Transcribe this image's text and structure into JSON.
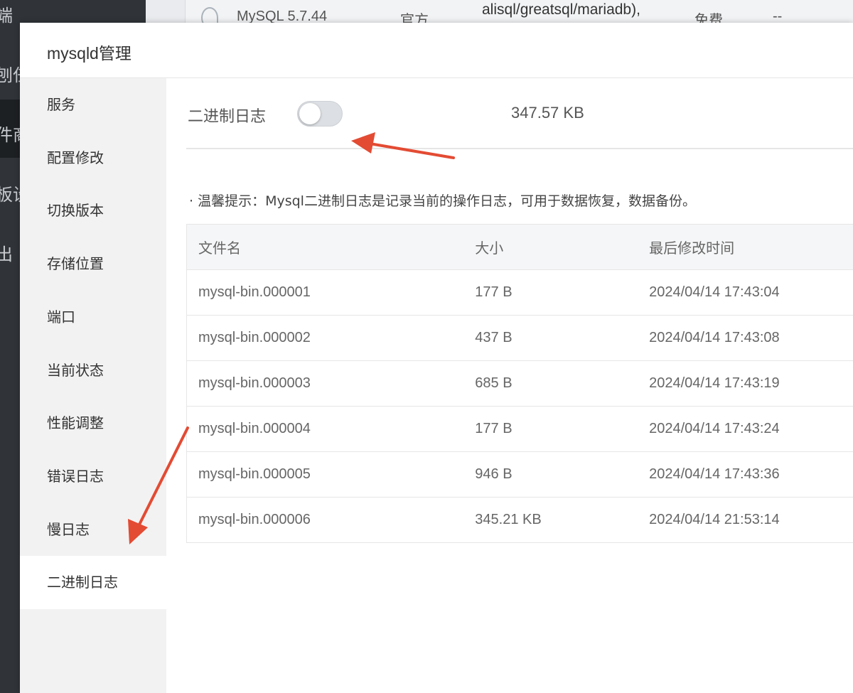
{
  "background": {
    "sidebar_fragments": [
      "端",
      "刨任",
      "件商",
      "板设",
      "出"
    ],
    "row": {
      "name": "MySQL 5.7.44",
      "source": "官方",
      "note": "alisql/greatsql/mariadb),",
      "price": "免费",
      "extra": "--"
    }
  },
  "modal": {
    "title": "mysqld管理",
    "sidebar": {
      "items": [
        {
          "label": "服务"
        },
        {
          "label": "配置修改"
        },
        {
          "label": "切换版本"
        },
        {
          "label": "存储位置"
        },
        {
          "label": "端口"
        },
        {
          "label": "当前状态"
        },
        {
          "label": "性能调整"
        },
        {
          "label": "错误日志"
        },
        {
          "label": "慢日志"
        },
        {
          "label": "二进制日志"
        }
      ],
      "active_index": 9
    },
    "binlog": {
      "label": "二进制日志",
      "toggle_on": false,
      "total_size": "347.57 KB",
      "tip": "· 温馨提示：Mysql二进制日志是记录当前的操作日志，可用于数据恢复，数据备份。"
    },
    "table": {
      "columns": [
        "文件名",
        "大小",
        "最后修改时间"
      ],
      "rows": [
        [
          "mysql-bin.000001",
          "177 B",
          "2024/04/14 17:43:04"
        ],
        [
          "mysql-bin.000002",
          "437 B",
          "2024/04/14 17:43:08"
        ],
        [
          "mysql-bin.000003",
          "685 B",
          "2024/04/14 17:43:19"
        ],
        [
          "mysql-bin.000004",
          "177 B",
          "2024/04/14 17:43:24"
        ],
        [
          "mysql-bin.000005",
          "946 B",
          "2024/04/14 17:43:36"
        ],
        [
          "mysql-bin.000006",
          "345.21 KB",
          "2024/04/14 21:53:14"
        ]
      ]
    }
  },
  "colors": {
    "accent_arrow": "#e34b33",
    "sidebar_bg": "#f2f2f2",
    "active_bg": "#ffffff"
  }
}
